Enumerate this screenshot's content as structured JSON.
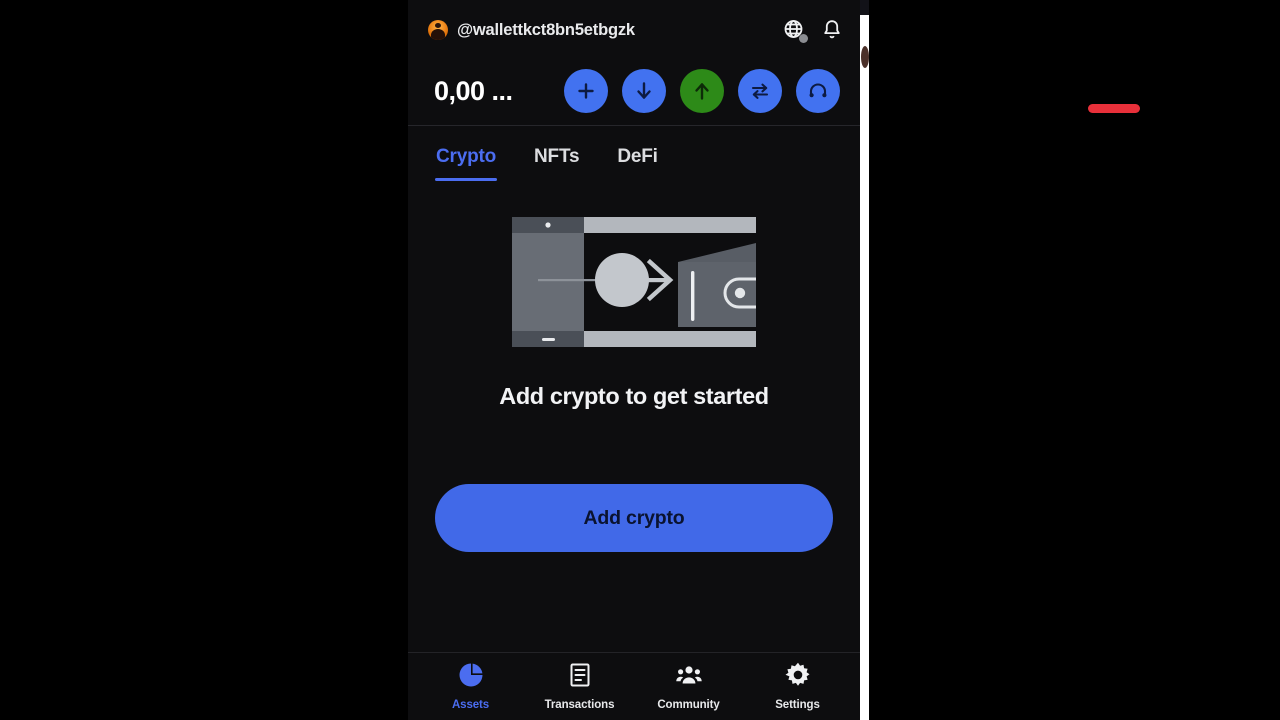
{
  "app": {
    "header": {
      "avatar_icon": "user-avatar",
      "username": "@wallettkct8bn5etbgzk",
      "globe_icon": "globe-icon",
      "bell_icon": "bell-icon",
      "balance": "0,00 ...",
      "actions": [
        {
          "name": "buy",
          "icon": "plus-icon",
          "color": "#4272f0",
          "label": ""
        },
        {
          "name": "receive",
          "icon": "arrow-down-icon",
          "color": "#4272f0",
          "label": ""
        },
        {
          "name": "send",
          "icon": "arrow-up-icon",
          "color": "#2d8a18",
          "label": "",
          "highlighted": true
        },
        {
          "name": "swap",
          "icon": "swap-arrows-icon",
          "color": "#4272f0",
          "label": ""
        },
        {
          "name": "support",
          "icon": "headphones-icon",
          "color": "#4272f0",
          "label": ""
        }
      ]
    },
    "tabs": [
      {
        "label": "Crypto",
        "active": true
      },
      {
        "label": "NFTs",
        "active": false
      },
      {
        "label": "DeFi",
        "active": false
      }
    ],
    "empty_state": {
      "illustration_icon": "phone-coin-to-wallet-illustration",
      "title": "Add crypto to get started",
      "cta_label": "Add crypto"
    },
    "bottom_nav": [
      {
        "label": "Assets",
        "icon": "pie-chart-icon",
        "active": true
      },
      {
        "label": "Transactions",
        "icon": "document-list-icon",
        "active": false
      },
      {
        "label": "Community",
        "icon": "people-group-icon",
        "active": false
      },
      {
        "label": "Settings",
        "icon": "gear-icon",
        "active": false
      }
    ]
  },
  "colors": {
    "accent_blue": "#4b6df0",
    "button_blue": "#4169e8",
    "send_green": "#2d8a18",
    "marker_red": "#e8303a",
    "panel_bg": "#0d0d0f"
  }
}
